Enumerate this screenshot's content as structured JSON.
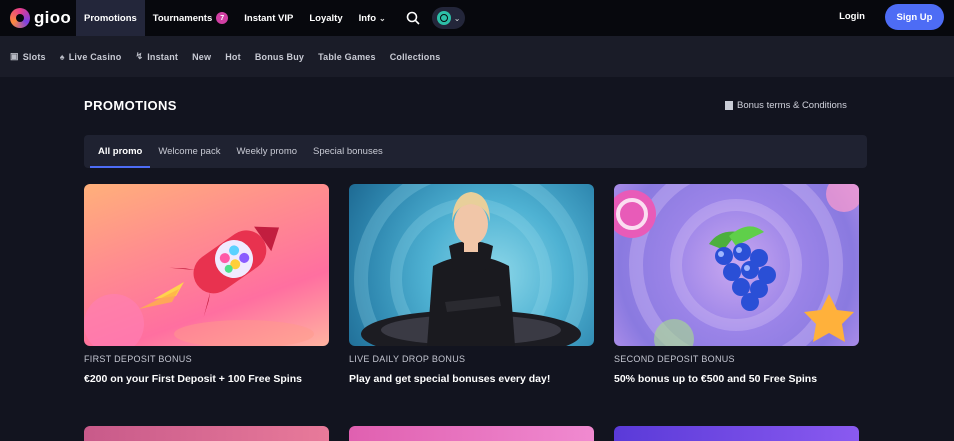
{
  "brand": {
    "name": "gioo"
  },
  "nav": {
    "items": [
      {
        "label": "Promotions",
        "active": true
      },
      {
        "label": "Tournaments",
        "badge": "7"
      },
      {
        "label": "Instant VIP"
      },
      {
        "label": "Loyalty"
      },
      {
        "label": "Info",
        "dropdown": true
      }
    ],
    "login_label": "Login",
    "signup_label": "Sign Up"
  },
  "categories": [
    {
      "label": "Slots",
      "icon": "slot-machine-icon"
    },
    {
      "label": "Live Casino",
      "icon": "spade-icon"
    },
    {
      "label": "Instant",
      "icon": "lightning-icon"
    },
    {
      "label": "New"
    },
    {
      "label": "Hot"
    },
    {
      "label": "Bonus Buy"
    },
    {
      "label": "Table Games"
    },
    {
      "label": "Collections"
    }
  ],
  "page": {
    "title": "PROMOTIONS",
    "terms_link": "Bonus terms & Conditions"
  },
  "tabs": [
    {
      "label": "All promo",
      "active": true
    },
    {
      "label": "Welcome pack"
    },
    {
      "label": "Weekly promo"
    },
    {
      "label": "Special bonuses"
    }
  ],
  "promos": [
    {
      "label": "FIRST DEPOSIT BONUS",
      "desc": "€200 on your First Deposit + 100 Free Spins"
    },
    {
      "label": "LIVE DAILY DROP BONUS",
      "desc": "Play and get special bonuses every day!"
    },
    {
      "label": "SECOND DEPOSIT BONUS",
      "desc": "50% bonus up to €500 and 50 Free Spins"
    }
  ],
  "colors": {
    "accent": "#4d6cf5",
    "badge": "#d13fa3",
    "background": "#12141f"
  }
}
